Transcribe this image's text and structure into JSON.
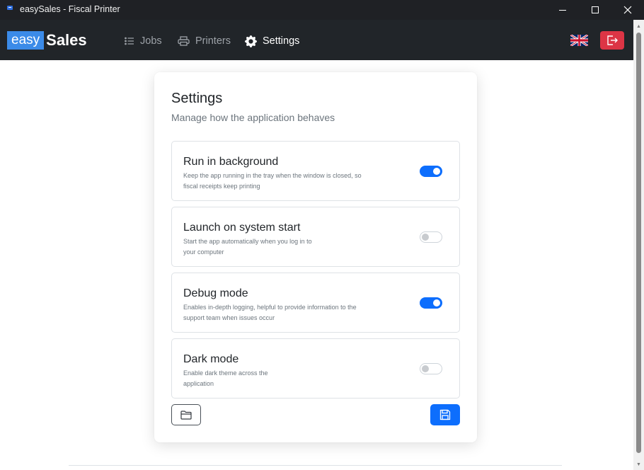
{
  "window": {
    "title": "easySales - Fiscal Printer"
  },
  "brand": {
    "part1": "easy",
    "part2": "Sales"
  },
  "nav": {
    "items": [
      {
        "label": "Jobs",
        "icon": "list-icon",
        "active": false
      },
      {
        "label": "Printers",
        "icon": "printer-icon",
        "active": false
      },
      {
        "label": "Settings",
        "icon": "gear-icon",
        "active": true
      }
    ],
    "language_icon": "uk-flag-icon",
    "logout_icon": "logout-icon"
  },
  "colors": {
    "accent": "#0d6efd",
    "danger": "#dc3545",
    "navbar": "#212529",
    "brand": "#3b8be8"
  },
  "settings": {
    "title": "Settings",
    "subtitle": "Manage how the application behaves",
    "items": [
      {
        "title": "Run in background",
        "desc_line1": "Keep the app running in the tray when the window is closed, so",
        "desc_line2": "fiscal receipts keep printing",
        "enabled": true
      },
      {
        "title": "Launch on system start",
        "desc_line1": "Start the app automatically when you log in to",
        "desc_line2": "your computer",
        "enabled": false
      },
      {
        "title": "Debug mode",
        "desc_line1": "Enables in-depth logging, helpful to provide information to the",
        "desc_line2": "support team when issues occur",
        "enabled": true
      },
      {
        "title": "Dark mode",
        "desc_line1": "Enable dark theme across the",
        "desc_line2": "application",
        "enabled": false
      }
    ],
    "folder_icon": "folder-icon",
    "save_icon": "save-icon"
  }
}
